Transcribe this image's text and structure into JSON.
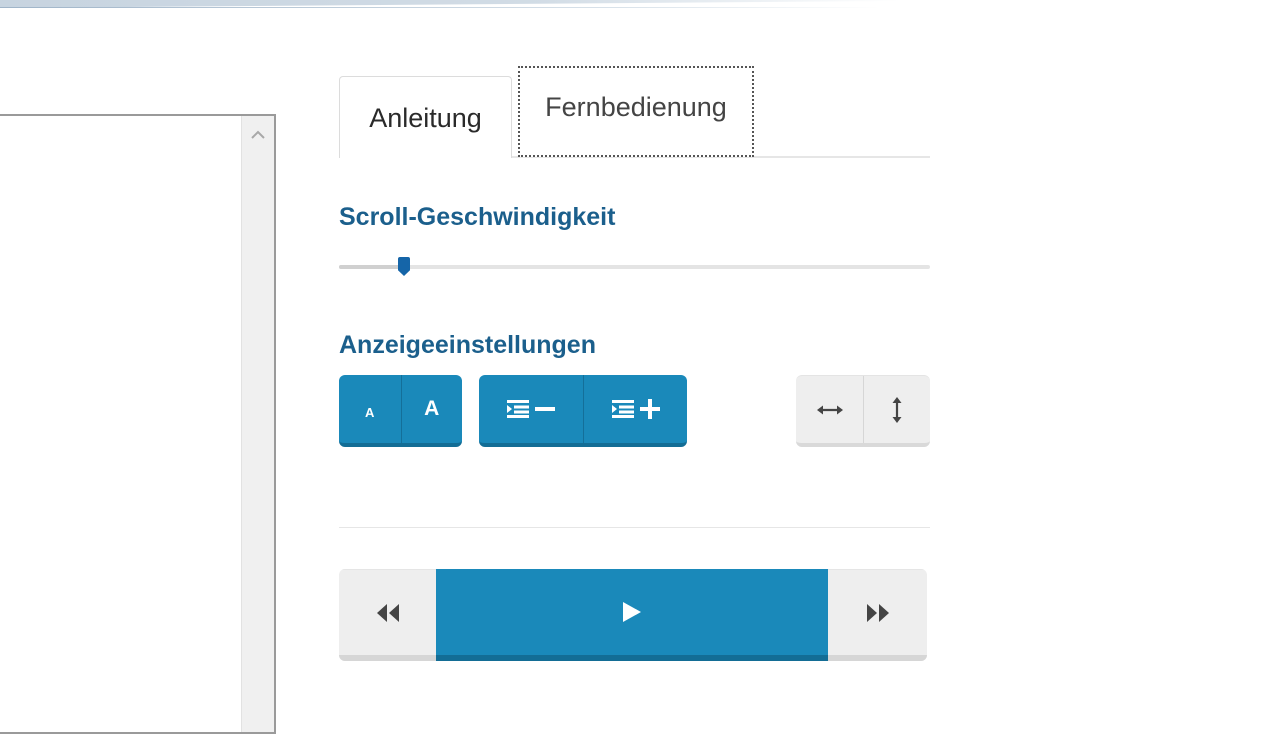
{
  "tabs": [
    {
      "label": "Anleitung",
      "active": false
    },
    {
      "label": "Fernbedienung",
      "active": true,
      "focused": true
    }
  ],
  "speed": {
    "title": "Scroll-Geschwindigkeit",
    "value": 0.11
  },
  "display": {
    "title": "Anzeigeeinstellungen",
    "font_small_label": "A",
    "font_large_label": "A",
    "indent_decrease_icon": "indent-decrease-icon",
    "indent_increase_icon": "indent-increase-icon",
    "flip_horizontal_icon": "arrows-horizontal-icon",
    "flip_vertical_icon": "arrows-vertical-icon"
  },
  "player": {
    "rewind_icon": "rewind-icon",
    "play_icon": "play-icon",
    "forward_icon": "fast-forward-icon"
  },
  "colors": {
    "accent": "#1a89ba",
    "accent_dark": "#136d95",
    "heading": "#1b5f8c",
    "slider_thumb": "#1565a8",
    "neutral_button": "#eeeeee"
  }
}
